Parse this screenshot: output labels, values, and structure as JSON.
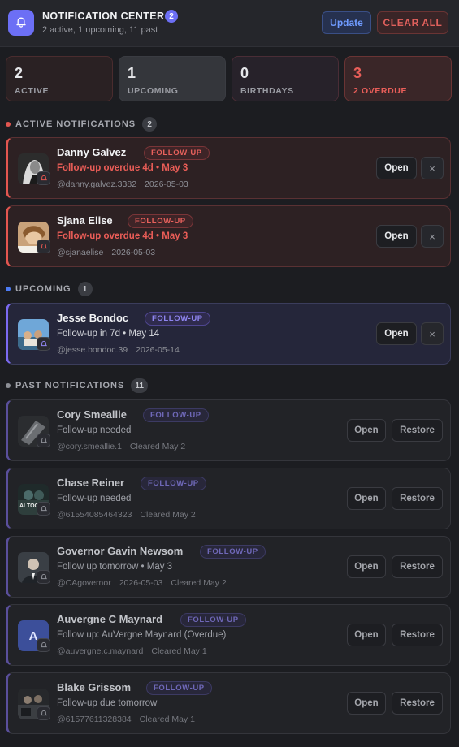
{
  "header": {
    "title": "NOTIFICATION CENTER",
    "badge": "2",
    "subtitle": "2 active, 1 upcoming, 11 past",
    "update_label": "Update",
    "clear_label": "CLEAR ALL"
  },
  "stats": {
    "active": {
      "num": "2",
      "label": "ACTIVE"
    },
    "upcoming": {
      "num": "1",
      "label": "UPCOMING"
    },
    "birthdays": {
      "num": "0",
      "label": "BIRTHDAYS"
    },
    "overdue": {
      "num": "3",
      "label": "2 OVERDUE"
    }
  },
  "sections": {
    "active": {
      "title": "ACTIVE NOTIFICATIONS",
      "count": "2",
      "dot_color": "#e25650"
    },
    "upcoming": {
      "title": "UPCOMING",
      "count": "1",
      "dot_color": "#4d7cf5"
    },
    "past": {
      "title": "PAST NOTIFICATIONS",
      "count": "11",
      "dot_color": "#8d8f96"
    }
  },
  "active_items": [
    {
      "name": "Danny Galvez",
      "tag": "FOLLOW-UP",
      "line2": "Follow-up overdue 4d • May 3",
      "handle": "@danny.galvez.3382",
      "date": "2026-05-03",
      "open": "Open",
      "dismiss": "×"
    },
    {
      "name": "Sjana Elise",
      "tag": "FOLLOW-UP",
      "line2": "Follow-up overdue 4d • May 3",
      "handle": "@sjanaelise",
      "date": "2026-05-03",
      "open": "Open",
      "dismiss": "×"
    }
  ],
  "upcoming_items": [
    {
      "name": "Jesse Bondoc",
      "tag": "FOLLOW-UP",
      "line2": "Follow-up in 7d • May 14",
      "handle": "@jesse.bondoc.39",
      "date": "2026-05-14",
      "open": "Open",
      "dismiss": "×"
    }
  ],
  "past_items": [
    {
      "name": "Cory Smeallie",
      "tag": "FOLLOW-UP",
      "line2": "Follow-up needed",
      "handle": "@cory.smeallie.1",
      "date": "",
      "cleared": "Cleared May 2",
      "open": "Open",
      "restore": "Restore"
    },
    {
      "name": "Chase Reiner",
      "tag": "FOLLOW-UP",
      "line2": "Follow-up needed",
      "handle": "@61554085464323",
      "date": "",
      "cleared": "Cleared May 2",
      "open": "Open",
      "restore": "Restore"
    },
    {
      "name": "Governor Gavin Newsom",
      "tag": "FOLLOW-UP",
      "line2": "Follow up tomorrow • May 3",
      "handle": "@CAgovernor",
      "date": "2026-05-03",
      "cleared": "Cleared May 2",
      "open": "Open",
      "restore": "Restore"
    },
    {
      "name": "Auvergne C Maynard",
      "tag": "FOLLOW-UP",
      "line2": "Follow up: AuVergne Maynard (Overdue)",
      "handle": "@auvergne.c.maynard",
      "date": "",
      "cleared": "Cleared May 1",
      "open": "Open",
      "restore": "Restore",
      "avatar_letter": "A"
    },
    {
      "name": "Blake Grissom",
      "tag": "FOLLOW-UP",
      "line2": "Follow-up due tomorrow",
      "handle": "@61577611328384",
      "date": "",
      "cleared": "Cleared May 1",
      "open": "Open",
      "restore": "Restore"
    }
  ],
  "colors": {
    "accent": "#6c6ff5",
    "danger": "#e25650",
    "upcoming": "#7b6af0",
    "background": "#1c1d21"
  }
}
